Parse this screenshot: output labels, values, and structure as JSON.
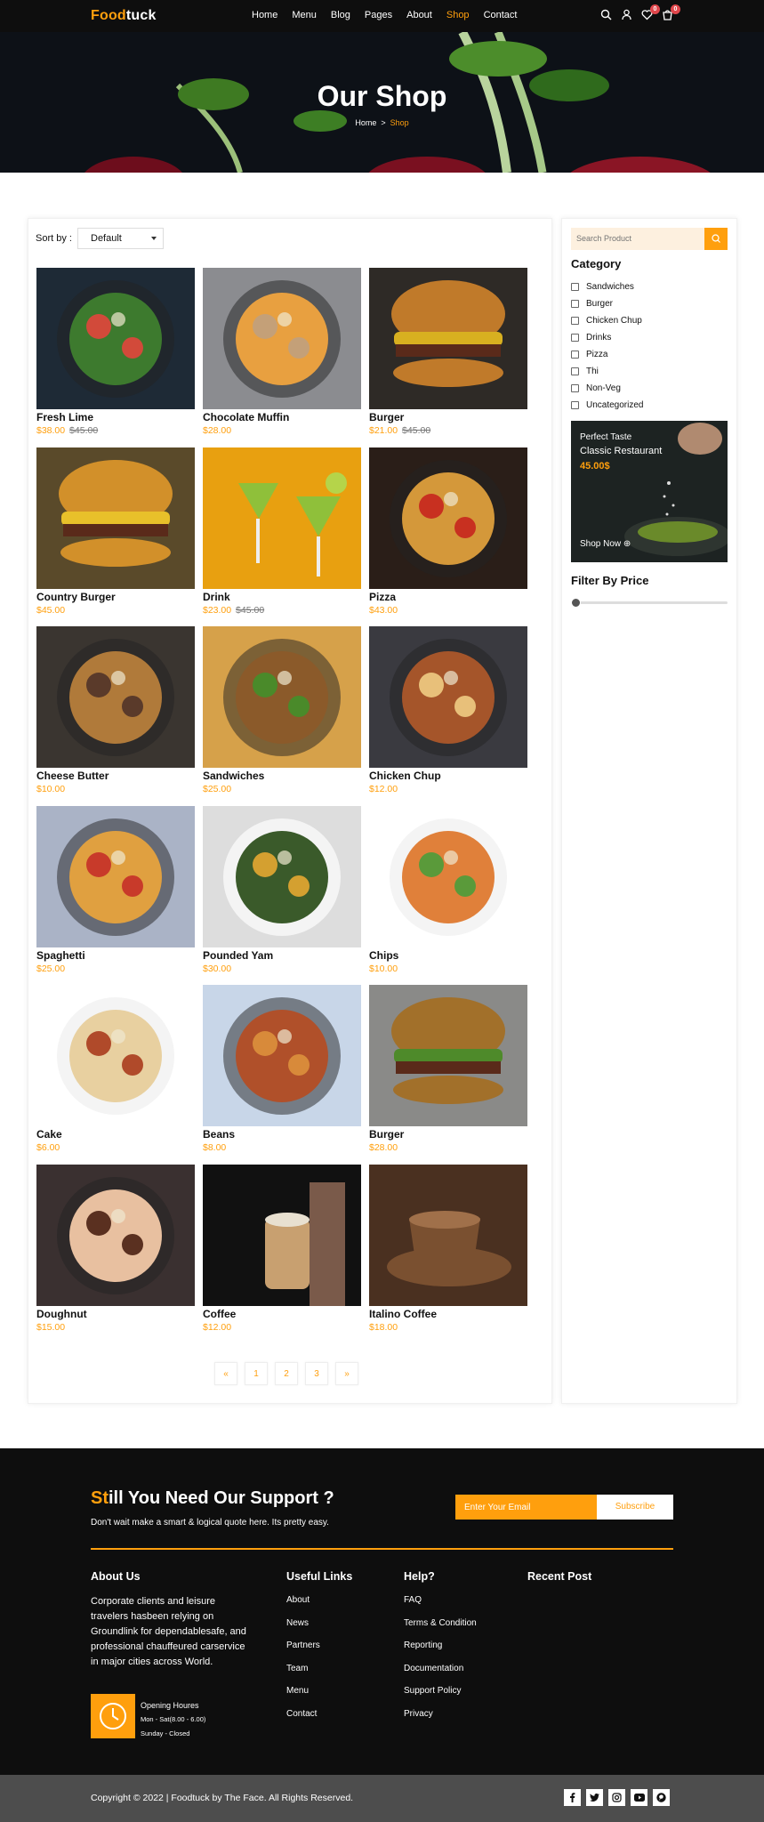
{
  "brand": {
    "logo_a": "Food",
    "logo_b": "tuck",
    "accent": "#ff9f0d"
  },
  "nav": {
    "items": [
      "Home",
      "Menu",
      "Blog",
      "Pages",
      "About",
      "Shop",
      "Contact"
    ],
    "active": "Shop"
  },
  "header_icons": {
    "search": "search-icon",
    "user": "user-icon",
    "wishlist": "heart-icon",
    "wishlist_count": "0",
    "cart": "cart-icon",
    "cart_count": "0"
  },
  "hero": {
    "title": "Our Shop",
    "crumb_home": "Home",
    "crumb_sep": ">",
    "crumb_current": "Shop"
  },
  "sort": {
    "label": "Sort by :",
    "value": "Default"
  },
  "products": [
    {
      "name": "Fresh Lime",
      "price": "$38.00",
      "old": "$45.00"
    },
    {
      "name": "Chocolate Muffin",
      "price": "$28.00",
      "old": ""
    },
    {
      "name": "Burger",
      "price": "$21.00",
      "old": "$45.00"
    },
    {
      "name": "Country Burger",
      "price": "$45.00",
      "old": ""
    },
    {
      "name": "Drink",
      "price": "$23.00",
      "old": "$45.00"
    },
    {
      "name": "Pizza",
      "price": "$43.00",
      "old": ""
    },
    {
      "name": "Cheese Butter",
      "price": "$10.00",
      "old": ""
    },
    {
      "name": "Sandwiches",
      "price": "$25.00",
      "old": ""
    },
    {
      "name": "Chicken Chup",
      "price": "$12.00",
      "old": ""
    },
    {
      "name": "Spaghetti",
      "price": "$25.00",
      "old": ""
    },
    {
      "name": "Pounded Yam",
      "price": "$30.00",
      "old": ""
    },
    {
      "name": "Chips",
      "price": "$10.00",
      "old": ""
    },
    {
      "name": "Cake",
      "price": "$6.00",
      "old": ""
    },
    {
      "name": "Beans",
      "price": "$8.00",
      "old": ""
    },
    {
      "name": "Burger",
      "price": "$28.00",
      "old": ""
    },
    {
      "name": "Doughnut",
      "price": "$15.00",
      "old": ""
    },
    {
      "name": "Coffee",
      "price": "$12.00",
      "old": ""
    },
    {
      "name": "Italino Coffee",
      "price": "$18.00",
      "old": ""
    }
  ],
  "pagination": [
    "«",
    "1",
    "2",
    "3",
    "»"
  ],
  "sidebar": {
    "search_placeholder": "Search Product",
    "category_title": "Category",
    "categories": [
      "Sandwiches",
      "Burger",
      "Chicken Chup",
      "Drinks",
      "Pizza",
      "Thi",
      "Non-Veg",
      "Uncategorized"
    ],
    "promo": {
      "line1": "Perfect Taste",
      "line2": "Classic Restaurant",
      "price": "45.00$",
      "cta": "Shop Now"
    },
    "price_filter_title": "Filter By Price"
  },
  "footer": {
    "support_title_acc": "St",
    "support_title_rest": "ill You Need Our Support ?",
    "support_sub": "Don't wait make a smart & logical quote here. Its pretty easy.",
    "email_placeholder": "Enter Your Email",
    "subscribe": "Subscribe",
    "about_title": "About Us",
    "about_text": "Corporate clients and leisure travelers hasbeen relying on Groundlink for dependablesafe, and professional chauffeured carservice in major cities across World.",
    "hours_title": "Opening Houres",
    "hours_line1": "Mon - Sat(8.00 - 6.00)",
    "hours_line2": "Sunday - Closed",
    "useful_title": "Useful Links",
    "useful": [
      "About",
      "News",
      "Partners",
      "Team",
      "Menu",
      "Contact"
    ],
    "help_title": "Help?",
    "help": [
      "FAQ",
      "Terms & Condition",
      "Reporting",
      "Documentation",
      "Support Policy",
      "Privacy"
    ],
    "recent_title": "Recent Post",
    "copyright": "Copyright © 2022 | Foodtuck by The Face. All Rights Reserved.",
    "social": [
      "facebook-icon",
      "twitter-icon",
      "instagram-icon",
      "youtube-icon",
      "pinterest-icon"
    ]
  }
}
